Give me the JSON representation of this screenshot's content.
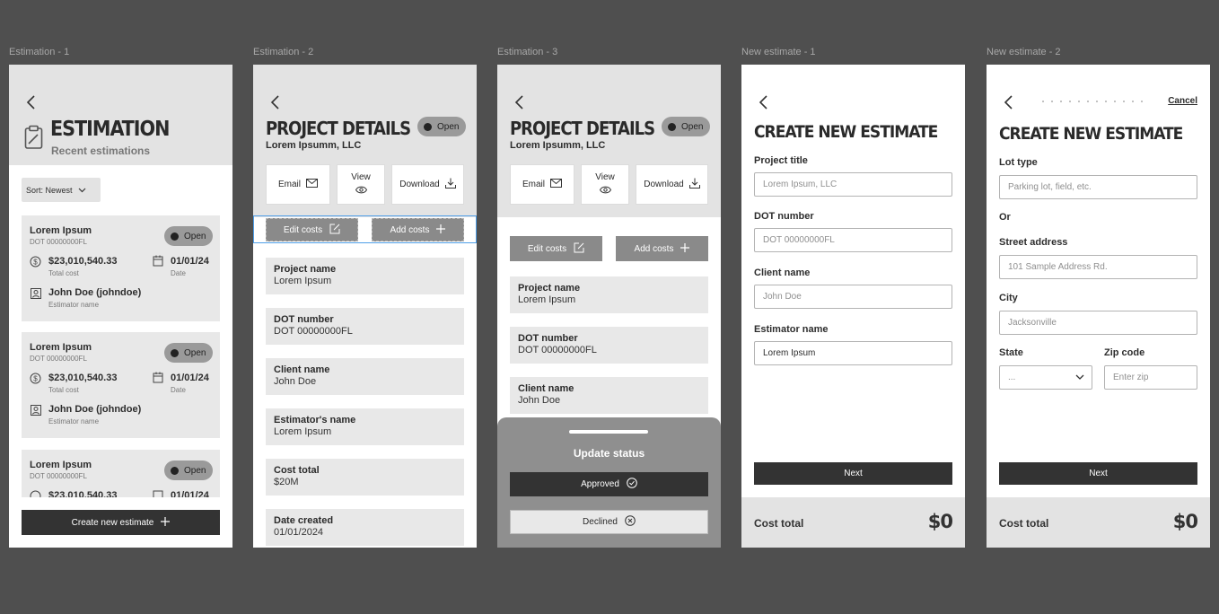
{
  "frames": [
    {
      "label": "Estimation - 1",
      "title": "ESTIMATION",
      "subtitle": "Recent estimations",
      "sort_label": "Sort: Newest",
      "cards": [
        {
          "name": "Lorem Ipsum",
          "dot": "DOT 00000000FL",
          "status": "Open",
          "cost": "$23,010,540.33",
          "cost_label": "Total cost",
          "date": "01/01/24",
          "date_label": "Date",
          "estimator": "John Doe (johndoe)",
          "estimator_label": "Estimator name"
        },
        {
          "name": "Lorem Ipsum",
          "dot": "DOT 00000000FL",
          "status": "Open",
          "cost": "$23,010,540.33",
          "cost_label": "Total cost",
          "date": "01/01/24",
          "date_label": "Date",
          "estimator": "John Doe (johndoe)",
          "estimator_label": "Estimator name"
        },
        {
          "name": "Lorem Ipsum",
          "dot": "DOT 00000000FL",
          "status": "Open",
          "cost": "$23,010,540.33",
          "date": "01/01/24"
        }
      ],
      "create_button": "Create new estimate"
    },
    {
      "label": "Estimation - 2",
      "title": "PROJECT DETAILS",
      "company": "Lorem Ipsumm, LLC",
      "status": "Open",
      "actions": {
        "email": "Email",
        "view": "View",
        "download": "Download"
      },
      "edit_costs": "Edit costs",
      "add_costs": "Add costs",
      "fields": [
        {
          "k": "Project name",
          "v": "Lorem Ipsum"
        },
        {
          "k": "DOT number",
          "v": "DOT 00000000FL"
        },
        {
          "k": "Client name",
          "v": "John Doe"
        },
        {
          "k": "Estimator's name",
          "v": "Lorem Ipsum"
        },
        {
          "k": "Cost total",
          "v": "$20M"
        },
        {
          "k": "Date created",
          "v": "01/01/2024"
        }
      ]
    },
    {
      "label": "Estimation - 3",
      "title": "PROJECT DETAILS",
      "company": "Lorem Ipsumm, LLC",
      "status": "Open",
      "actions": {
        "email": "Email",
        "view": "View",
        "download": "Download"
      },
      "edit_costs": "Edit costs",
      "add_costs": "Add costs",
      "fields": [
        {
          "k": "Project name",
          "v": "Lorem Ipsum"
        },
        {
          "k": "DOT number",
          "v": "DOT 00000000FL"
        },
        {
          "k": "Client name",
          "v": "John Doe"
        }
      ],
      "sheet": {
        "title": "Update status",
        "approved": "Approved",
        "declined": "Declined"
      }
    },
    {
      "label": "New estimate - 1",
      "title": "CREATE NEW ESTIMATE",
      "fields": [
        {
          "label": "Project title",
          "placeholder": "Lorem Ipsum, LLC"
        },
        {
          "label": "DOT number",
          "placeholder": "DOT 00000000FL"
        },
        {
          "label": "Client name",
          "placeholder": "John Doe"
        },
        {
          "label": "Estimator name",
          "value": "Lorem Ipsum"
        }
      ],
      "next": "Next",
      "cost_total_label": "Cost total",
      "cost_total_value": "$0"
    },
    {
      "label": "New estimate - 2",
      "cancel": "Cancel",
      "title": "CREATE NEW ESTIMATE",
      "lot_type_label": "Lot type",
      "lot_type_placeholder": "Parking lot, field, etc.",
      "or": "Or",
      "street_label": "Street address",
      "street_placeholder": "101 Sample Address Rd.",
      "city_label": "City",
      "city_placeholder": "Jacksonville",
      "state_label": "State",
      "state_value": "...",
      "zip_label": "Zip code",
      "zip_placeholder": "Enter zip",
      "next": "Next",
      "cost_total_label": "Cost total",
      "cost_total_value": "$0"
    }
  ]
}
